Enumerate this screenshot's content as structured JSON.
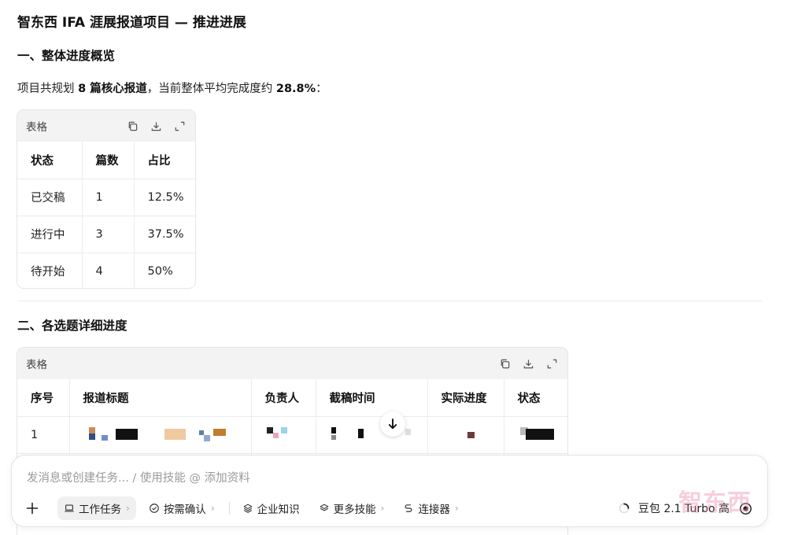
{
  "doc": {
    "title": "智东西 IFA 涯展报道项目 — 推进进展",
    "section1_title": "一、整体进度概览",
    "intro_prefix": "项目共规划",
    "intro_bold1": "8 篇核心报道",
    "intro_mid": "，当前整体平均完成度约",
    "intro_bold2": "28.8%",
    "intro_suffix": "：",
    "section2_title": "二、各选题详细进度"
  },
  "table1": {
    "label": "表格",
    "headers": [
      "状态",
      "篇数",
      "占比"
    ],
    "rows": [
      [
        "已交稿",
        "1",
        "12.5%"
      ],
      [
        "进行中",
        "3",
        "37.5%"
      ],
      [
        "待开始",
        "4",
        "50%"
      ]
    ]
  },
  "table2": {
    "label": "表格",
    "headers": [
      "序号",
      "报道标题",
      "负责人",
      "截稿时间",
      "实际进度",
      "状态"
    ],
    "rows": [
      [
        "1"
      ]
    ]
  },
  "composer": {
    "placeholder": "发消息或创建任务... / 使用技能 @ 添加资料",
    "tools": [
      "工作任务",
      "按需确认",
      "企业知识",
      "更多技能",
      "连接器"
    ],
    "model": "豆包 2.1 Turbo 高"
  },
  "watermark": "智东西",
  "icons": {
    "copy": "copy-icon",
    "download": "download-icon",
    "expand": "expand-icon",
    "plus": "plus-icon",
    "laptop": "laptop-icon",
    "check": "check-circle-icon",
    "layers": "layers-icon",
    "link": "link-icon",
    "spinner": "loading-icon",
    "voice": "voice-icon"
  }
}
